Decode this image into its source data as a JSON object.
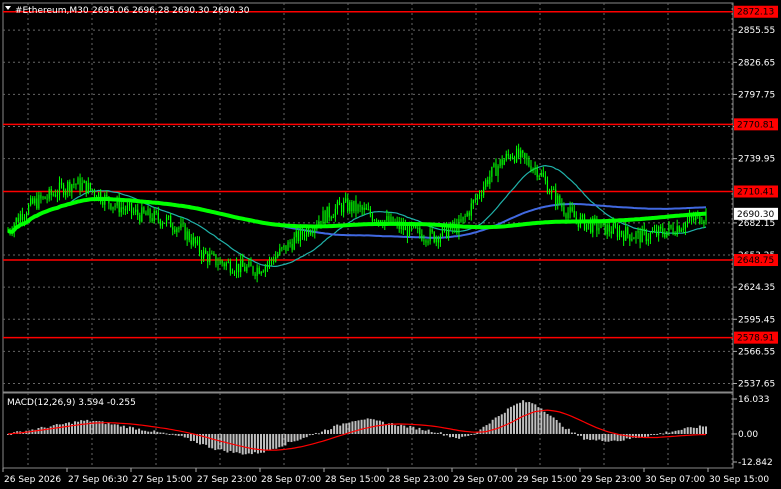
{
  "header": {
    "symbol": "#Ethereum,M30",
    "ohlc": "2695.06 2696.28 2690.30 2690.30"
  },
  "colors": {
    "background": "#000000",
    "grid": "#666666",
    "text": "#ffffff",
    "level_line": "#ff0000",
    "level_label_bg": "#ff0000",
    "price_label_bg": "#ffffff",
    "candles": "#00ff00",
    "ma_fast": "#00ff00",
    "ma_slow": "#4169e1",
    "ma_mid": "#20b2aa",
    "macd_hist": "#c0c0c0",
    "macd_signal": "#ff0000"
  },
  "price_axis": {
    "ticks": [
      "2855.55",
      "2826.65",
      "2797.75",
      "2768.85",
      "2739.95",
      "2682.15",
      "2653.25",
      "2624.35",
      "2595.45",
      "2566.55",
      "2537.65"
    ]
  },
  "levels": [
    {
      "label": "2872.13",
      "price": 2872.13
    },
    {
      "label": "2770.81",
      "price": 2770.81
    },
    {
      "label": "2710.41",
      "price": 2710.41
    },
    {
      "label": "2648.75",
      "price": 2648.75
    },
    {
      "label": "2578.91",
      "price": 2578.91
    }
  ],
  "current_price": {
    "label": "2690.30",
    "price": 2690.3
  },
  "macd": {
    "title": "MACD(12,26,9) 3.594 -0.255",
    "ticks": [
      "16.033",
      "0.00",
      "-12.842"
    ],
    "max": 16.033,
    "min": -12.842
  },
  "time_axis": {
    "labels": [
      "26 Sep 2026",
      "27 Sep 06:30",
      "27 Sep 15:00",
      "27 Sep 23:00",
      "28 Sep 07:00",
      "28 Sep 15:00",
      "28 Sep 23:00",
      "29 Sep 07:00",
      "29 Sep 15:00",
      "29 Sep 23:00",
      "30 Sep 07:00",
      "30 Sep 15:00"
    ]
  },
  "chart_data": {
    "type": "candlestick",
    "ylim": [
      2530,
      2880
    ],
    "price_path": [
      2675,
      2690,
      2700,
      2705,
      2712,
      2718,
      2715,
      2708,
      2700,
      2695,
      2690,
      2688,
      2685,
      2680,
      2670,
      2655,
      2648,
      2645,
      2642,
      2640,
      2645,
      2655,
      2665,
      2675,
      2685,
      2692,
      2698,
      2695,
      2690,
      2685,
      2680,
      2675,
      2672,
      2670,
      2675,
      2680,
      2700,
      2720,
      2735,
      2745,
      2738,
      2730,
      2710,
      2695,
      2685,
      2680,
      2678,
      2675,
      2672,
      2670,
      2672,
      2675,
      2680,
      2685,
      2690
    ],
    "macd_hist": [
      0,
      1,
      2,
      3,
      4,
      5,
      6,
      6,
      5,
      4,
      3,
      2,
      1,
      0,
      -1,
      -3,
      -5,
      -7,
      -8,
      -9,
      -9,
      -8,
      -6,
      -4,
      -2,
      0,
      2,
      4,
      6,
      7,
      6,
      5,
      4,
      3,
      2,
      1,
      -1,
      -2,
      0,
      4,
      8,
      12,
      15,
      14,
      10,
      5,
      1,
      -2,
      -3,
      -3,
      -3,
      -2,
      -1,
      0,
      1,
      2,
      3,
      3.6
    ],
    "macd_signal": [
      0,
      0.5,
      1.2,
      2,
      2.8,
      3.6,
      4.4,
      5,
      5.2,
      5,
      4.6,
      4,
      3.2,
      2.4,
      1.4,
      0.2,
      -1.2,
      -2.8,
      -4.2,
      -5.6,
      -6.8,
      -7.4,
      -7.4,
      -6.8,
      -5.8,
      -4.4,
      -2.8,
      -1,
      0.8,
      2.4,
      3.6,
      4.4,
      4.6,
      4.4,
      4,
      3.4,
      2.4,
      1.4,
      0.8,
      1,
      2.6,
      5,
      8,
      10.2,
      11,
      10.2,
      8.2,
      5.6,
      3,
      1,
      -0.4,
      -1.2,
      -1.6,
      -1.6,
      -1.2,
      -0.8,
      -0.4,
      -0.255
    ]
  }
}
